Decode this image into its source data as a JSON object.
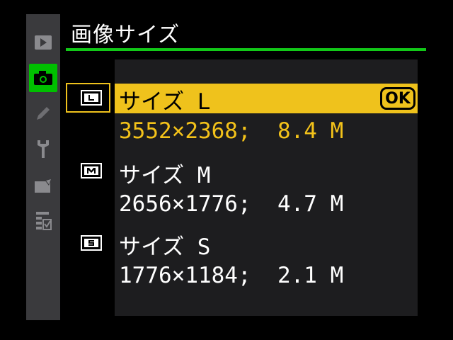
{
  "header": {
    "title": "画像サイズ"
  },
  "sidebar": {
    "items": [
      {
        "icon": "playback-icon",
        "active": false
      },
      {
        "icon": "camera-icon",
        "active": true
      },
      {
        "icon": "pencil-icon",
        "active": false
      },
      {
        "icon": "wrench-icon",
        "active": false
      },
      {
        "icon": "retouch-icon",
        "active": false
      },
      {
        "icon": "my-menu-icon",
        "active": false
      }
    ]
  },
  "options": [
    {
      "icon_label": "L",
      "label": "サイズ L",
      "detail": "3552×2368;  8.4 M",
      "selected": true
    },
    {
      "icon_label": "M",
      "label": "サイズ M",
      "detail": "2656×1776;  4.7 M",
      "selected": false
    },
    {
      "icon_label": "S",
      "label": "サイズ S",
      "detail": "1776×1184;  2.1 M",
      "selected": false
    }
  ],
  "confirm": {
    "label": "OK"
  },
  "colors": {
    "accent_green": "#12c818",
    "highlight_yellow": "#efc21c",
    "panel": "#1d1d1f",
    "sidebar": "#3a3a3d"
  }
}
